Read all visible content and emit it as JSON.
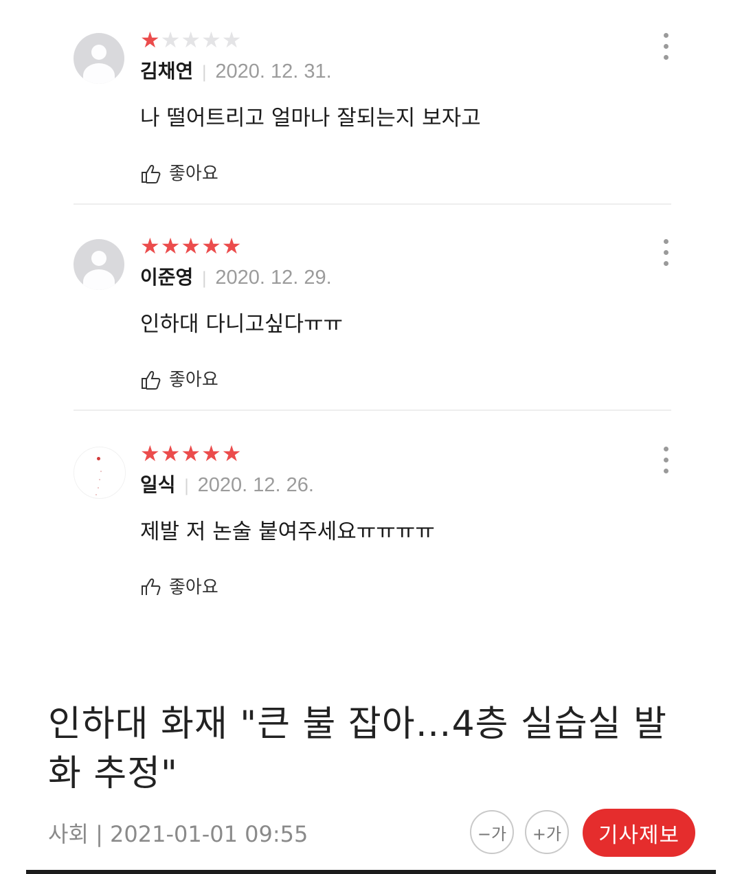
{
  "reviews": [
    {
      "rating": 1,
      "name": "김채연",
      "date": "2020. 12. 31.",
      "text": "나 떨어트리고 얼마나 잘되는지 보자고",
      "like_label": "좋아요",
      "avatar": "default-avatar"
    },
    {
      "rating": 5,
      "name": "이준영",
      "date": "2020. 12. 29.",
      "text": "인하대 다니고싶다ㅠㅠ",
      "like_label": "좋아요",
      "avatar": "default-avatar"
    },
    {
      "rating": 5,
      "name": "일식",
      "date": "2020. 12. 26.",
      "text": "제발 저 논술 붙여주세요ㅠㅠㅠㅠ",
      "like_label": "좋아요",
      "avatar": "custom-avatar"
    }
  ],
  "article": {
    "headline": "인하대 화재 \"큰 불 잡아…4층 실습실 발화 추정\"",
    "section": "사회",
    "separator": "|",
    "datetime": "2021-01-01 09:55",
    "font_smaller_label": "−가",
    "font_larger_label": "+가",
    "report_label": "기사제보"
  },
  "colors": {
    "star_on": "#eb4c4c",
    "star_off": "#e4e4e6",
    "report_button": "#e52d2d"
  }
}
